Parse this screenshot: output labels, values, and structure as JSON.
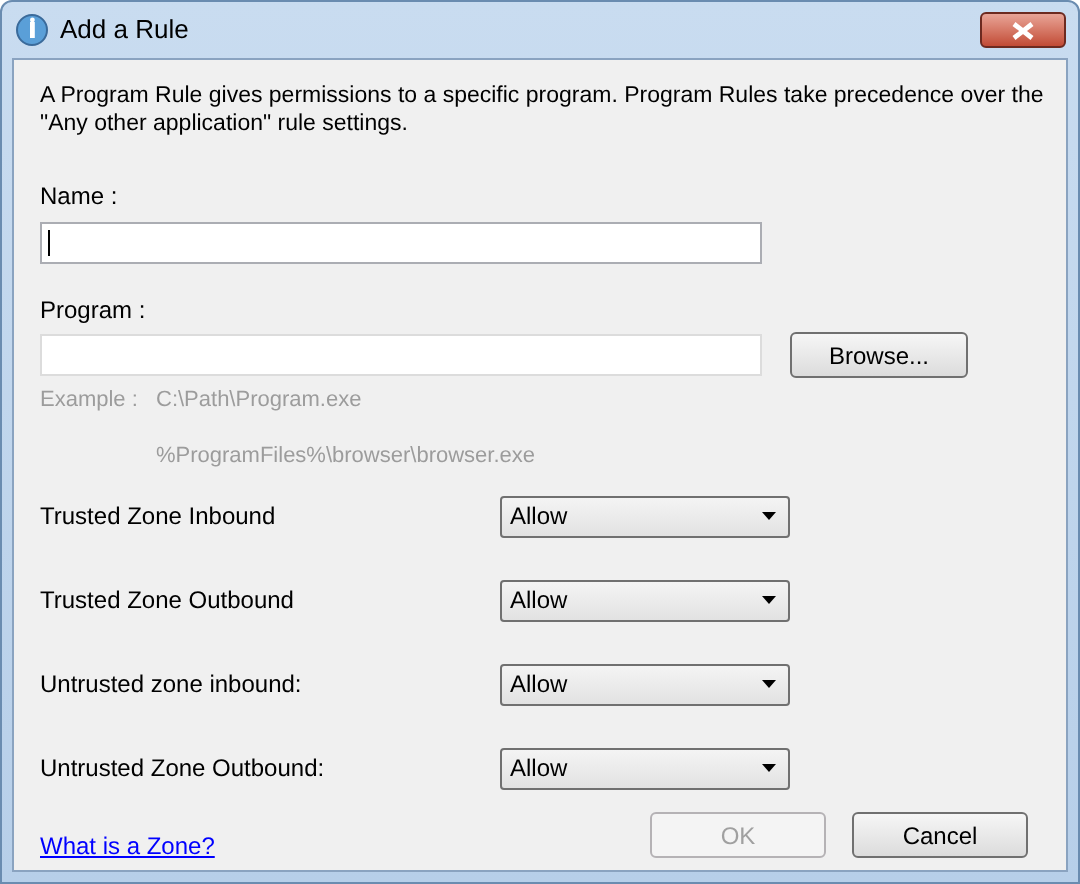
{
  "window": {
    "title": "Add a Rule"
  },
  "intro": "A Program Rule gives permissions to a specific program. Program Rules take precedence over the \"Any other application\" rule settings.",
  "name_field": {
    "label": "Name :",
    "focused": true
  },
  "program_field": {
    "label": "Program :"
  },
  "browse_button": "Browse...",
  "example_label": "Example :",
  "examples": [
    "C:\\Path\\Program.exe",
    "%ProgramFiles%\\browser\\browser.exe"
  ],
  "zone_rules": [
    {
      "label": "Trusted Zone Inbound",
      "value": "Allow"
    },
    {
      "label": "Trusted Zone Outbound",
      "value": "Allow"
    },
    {
      "label": "Untrusted zone inbound:",
      "value": "Allow"
    },
    {
      "label": "Untrusted Zone Outbound:",
      "value": "Allow"
    }
  ],
  "help_link": "What is a Zone?",
  "buttons": [
    {
      "label": "OK",
      "disabled": true
    },
    {
      "label": "Cancel",
      "disabled": false
    }
  ]
}
